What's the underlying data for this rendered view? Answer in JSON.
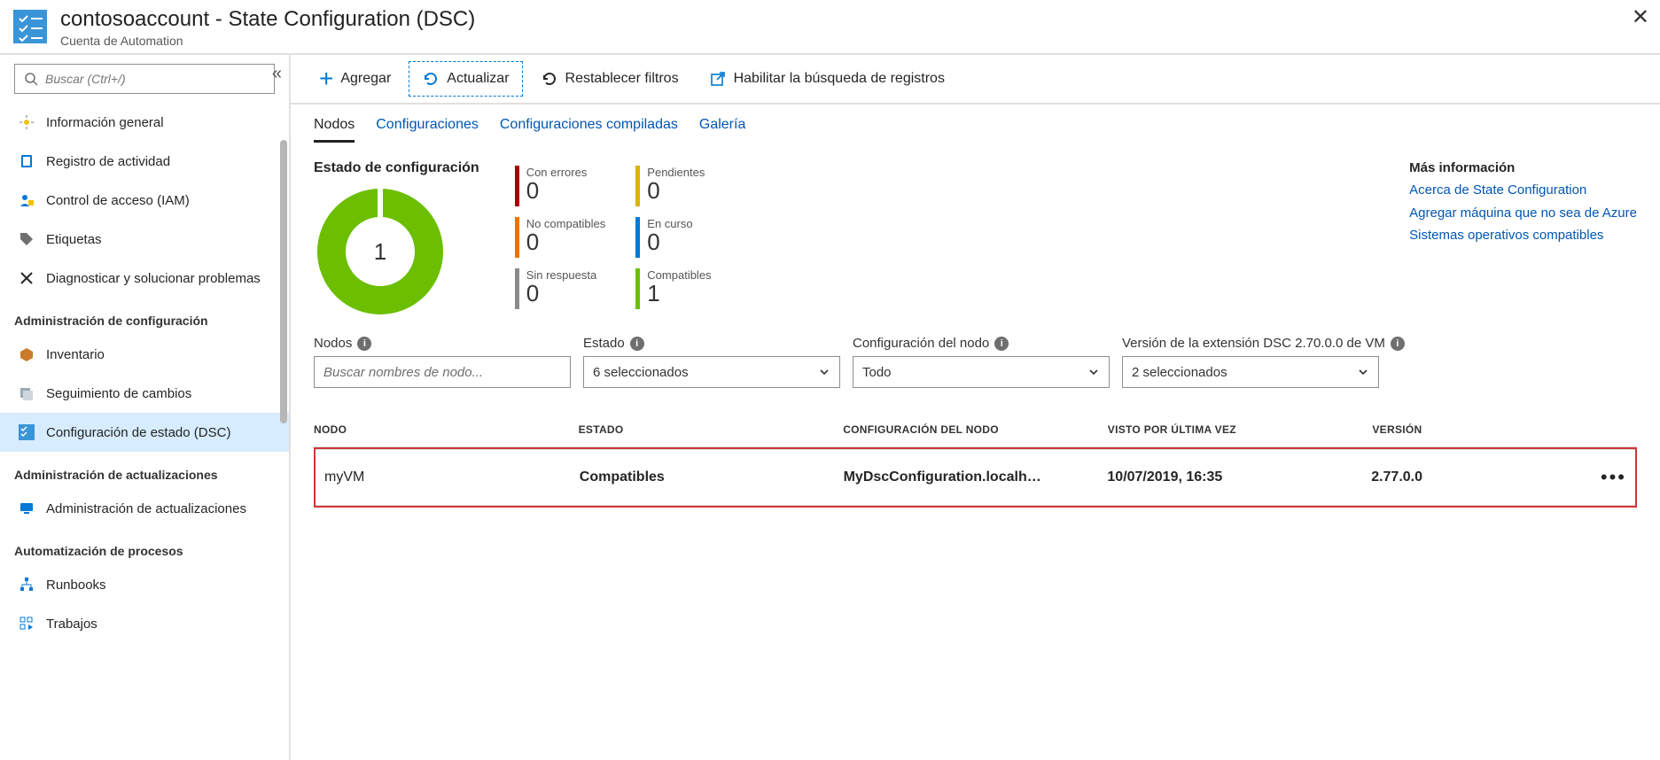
{
  "header": {
    "title": "contosoaccount - State Configuration (DSC)",
    "subtitle": "Cuenta de Automation"
  },
  "sidebar": {
    "search_placeholder": "Buscar (Ctrl+/)",
    "groups": [
      {
        "heading": null,
        "items": [
          "Información general",
          "Registro de actividad",
          "Control de acceso (IAM)",
          "Etiquetas",
          "Diagnosticar y solucionar problemas"
        ]
      },
      {
        "heading": "Administración de configuración",
        "items": [
          "Inventario",
          "Seguimiento de cambios",
          "Configuración de estado (DSC)"
        ]
      },
      {
        "heading": "Administración de actualizaciones",
        "items": [
          "Administración de actualizaciones"
        ]
      },
      {
        "heading": "Automatización de procesos",
        "items": [
          "Runbooks",
          "Trabajos"
        ]
      }
    ],
    "selected_item": "Configuración de estado (DSC)"
  },
  "toolbar": {
    "add": "Agregar",
    "refresh": "Actualizar",
    "reset": "Restablecer filtros",
    "enable_log": "Habilitar la búsqueda de registros"
  },
  "tabs": {
    "items": [
      "Nodos",
      "Configuraciones",
      "Configuraciones compiladas",
      "Galería"
    ],
    "active": "Nodos"
  },
  "status": {
    "heading": "Estado de configuración",
    "center_value": "1",
    "cards": {
      "errors": {
        "label": "Con errores",
        "value": "0",
        "color": "#a80000"
      },
      "pending": {
        "label": "Pendientes",
        "value": "0",
        "color": "#dbb400"
      },
      "noncompat": {
        "label": "No compatibles",
        "value": "0",
        "color": "#e87400"
      },
      "inprog": {
        "label": "En curso",
        "value": "0",
        "color": "#0078d4"
      },
      "noresp": {
        "label": "Sin respuesta",
        "value": "0",
        "color": "#8a8a8a"
      },
      "compat": {
        "label": "Compatibles",
        "value": "1",
        "color": "#6bbf00"
      }
    }
  },
  "info": {
    "heading": "Más información",
    "links": [
      "Acerca de State Configuration",
      "Agregar máquina que no sea de Azure",
      "Sistemas operativos compatibles"
    ]
  },
  "filters": {
    "nodes": {
      "label": "Nodos",
      "placeholder": "Buscar nombres de nodo..."
    },
    "state": {
      "label": "Estado",
      "value": "6 seleccionados"
    },
    "nodeconfig": {
      "label": "Configuración del nodo",
      "value": "Todo"
    },
    "version": {
      "label": "Versión de la extensión DSC 2.70.0.0 de VM",
      "value": "2 seleccionados"
    }
  },
  "table": {
    "headers": [
      "NODO",
      "ESTADO",
      "CONFIGURACIÓN DEL NODO",
      "VISTO POR ÚLTIMA VEZ",
      "VERSIÓN"
    ],
    "rows": [
      {
        "node": "myVM",
        "state": "Compatibles",
        "config": "MyDscConfiguration.localh…",
        "last": "10/07/2019, 16:35",
        "ver": "2.77.0.0"
      }
    ]
  }
}
